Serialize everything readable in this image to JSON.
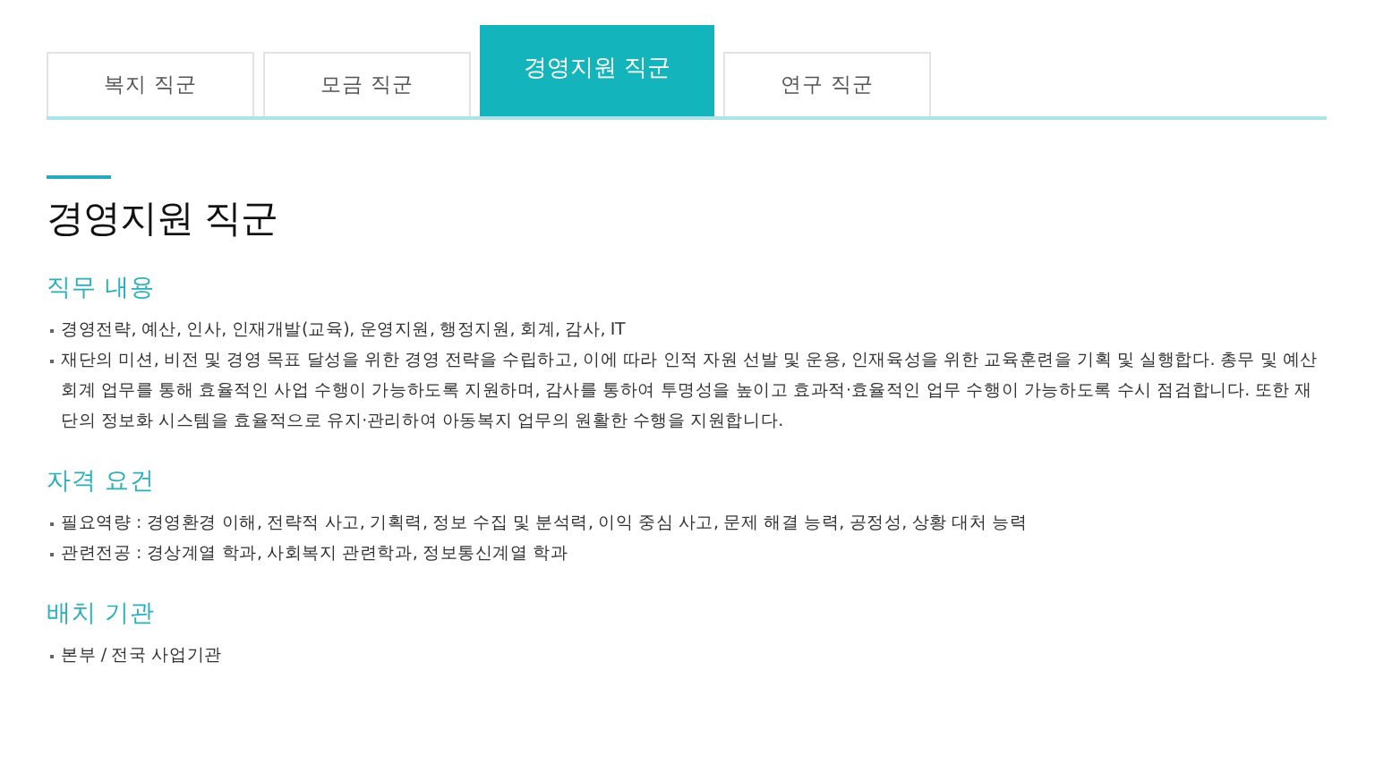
{
  "tabs": [
    {
      "label": "복지 직군",
      "selected": false
    },
    {
      "label": "모금 직군",
      "selected": false
    },
    {
      "label": "경영지원 직군",
      "selected": true
    },
    {
      "label": "연구 직군",
      "selected": false
    }
  ],
  "title": "경영지원 직군",
  "sections": [
    {
      "heading": "직무 내용",
      "items": [
        "경영전략, 예산, 인사, 인재개발(교육), 운영지원, 행정지원, 회계, 감사, IT",
        "재단의 미션, 비전 및 경영 목표 달성을 위한 경영 전략을 수립하고, 이에 따라 인적 자원 선발 및 운용, 인재육성을 위한 교육훈련을 기획 및 실행합다. 총무 및 예산회계 업무를 통해 효율적인 사업 수행이 가능하도록 지원하며, 감사를 통하여 투명성을 높이고 효과적·효율적인 업무 수행이 가능하도록 수시 점검합니다. 또한 재단의 정보화 시스템을 효율적으로 유지·관리하여 아동복지 업무의 원활한 수행을 지원합니다."
      ]
    },
    {
      "heading": "자격 요건",
      "items": [
        "필요역량 : 경영환경 이해, 전략적 사고, 기획력, 정보 수집 및 분석력, 이익 중심 사고, 문제 해결 능력, 공정성, 상황 대처 능력",
        "관련전공 : 경상계열 학과, 사회복지 관련학과, 정보통신계열 학과"
      ]
    },
    {
      "heading": "배치 기관",
      "items": [
        "본부 / 전국 사업기관"
      ]
    }
  ]
}
